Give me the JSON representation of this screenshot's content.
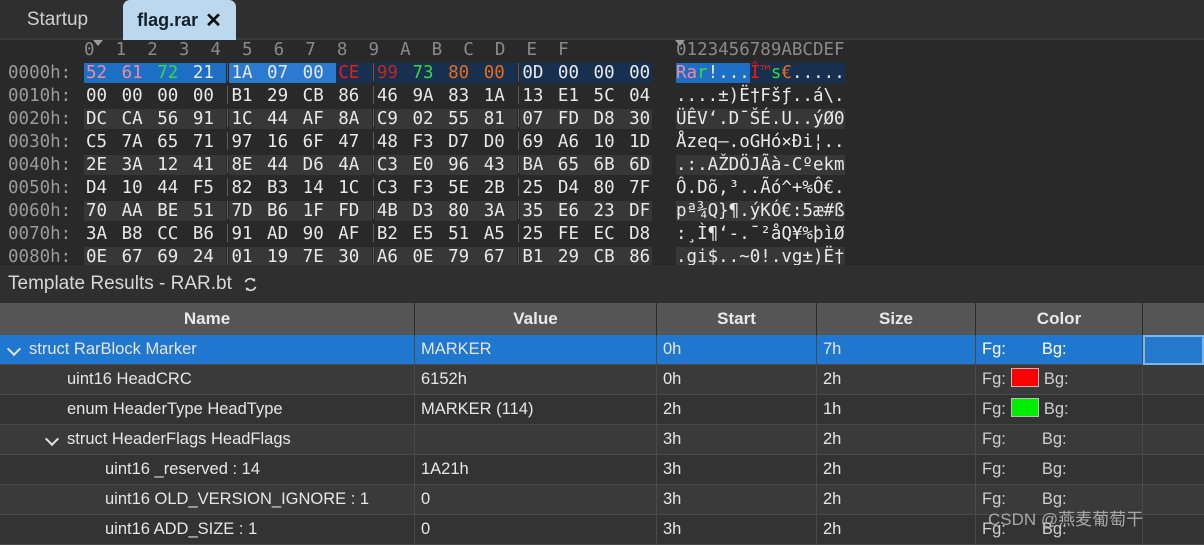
{
  "tabs": [
    {
      "label": "Startup",
      "active": false
    },
    {
      "label": "flag.rar",
      "active": true,
      "close_glyph": "✕"
    }
  ],
  "hex_editor": {
    "column_header": "0  1  2  3  4  5  6  7  8  9  A  B  C  D  E  F",
    "ascii_header": "0123456789ABCDEF",
    "rows": [
      {
        "offset": "0000h:",
        "ascii": "Rar!...Î™s€....."
      },
      {
        "offset": "0010h:",
        "ascii": "....±)Ë†Fšƒ..á\\."
      },
      {
        "offset": "0020h:",
        "ascii": "ÜÊV‘.D¯ŠÉ.U..ýØ0"
      },
      {
        "offset": "0030h:",
        "ascii": "Åzeq—.oGHó×Ði¦.."
      },
      {
        "offset": "0040h:",
        "ascii": ".:.AŽDÖJÃà-Cºekm"
      },
      {
        "offset": "0050h:",
        "ascii": "Ô.Dõ,³..Ãó^+%Ô€."
      },
      {
        "offset": "0060h:",
        "ascii": "pª¾Q}¶.ýKÓ€:5æ#ß"
      },
      {
        "offset": "0070h:",
        "ascii": ":¸Ì¶‘-.¯²åQ¥%þìØ"
      },
      {
        "offset": "0080h:",
        "ascii": ".gi$..~0!.vg±)Ë†"
      }
    ],
    "bytes": [
      [
        "52",
        "61",
        "72",
        "21",
        "1A",
        "07",
        "00",
        "CE",
        "99",
        "73",
        "80",
        "00",
        "0D",
        "00",
        "00",
        "00"
      ],
      [
        "00",
        "00",
        "00",
        "00",
        "B1",
        "29",
        "CB",
        "86",
        "46",
        "9A",
        "83",
        "1A",
        "13",
        "E1",
        "5C",
        "04"
      ],
      [
        "DC",
        "CA",
        "56",
        "91",
        "1C",
        "44",
        "AF",
        "8A",
        "C9",
        "02",
        "55",
        "81",
        "07",
        "FD",
        "D8",
        "30"
      ],
      [
        "C5",
        "7A",
        "65",
        "71",
        "97",
        "16",
        "6F",
        "47",
        "48",
        "F3",
        "D7",
        "D0",
        "69",
        "A6",
        "10",
        "1D"
      ],
      [
        "2E",
        "3A",
        "12",
        "41",
        "8E",
        "44",
        "D6",
        "4A",
        "C3",
        "E0",
        "96",
        "43",
        "BA",
        "65",
        "6B",
        "6D"
      ],
      [
        "D4",
        "10",
        "44",
        "F5",
        "82",
        "B3",
        "14",
        "1C",
        "C3",
        "F3",
        "5E",
        "2B",
        "25",
        "D4",
        "80",
        "7F"
      ],
      [
        "70",
        "AA",
        "BE",
        "51",
        "7D",
        "B6",
        "1F",
        "FD",
        "4B",
        "D3",
        "80",
        "3A",
        "35",
        "E6",
        "23",
        "DF"
      ],
      [
        "3A",
        "B8",
        "CC",
        "B6",
        "91",
        "AD",
        "90",
        "AF",
        "B2",
        "E5",
        "51",
        "A5",
        "25",
        "FE",
        "EC",
        "D8"
      ],
      [
        "0E",
        "67",
        "69",
        "24",
        "01",
        "19",
        "7E",
        "30",
        "A6",
        "0E",
        "79",
        "67",
        "B1",
        "29",
        "CB",
        "86"
      ]
    ],
    "highlight_colors": {
      "selection_strong": "#1c6fc4",
      "selection_mid": "#2a7ad1",
      "selection_dark": "#17304f",
      "pink": "#f08a9c",
      "green": "#34d94a",
      "red": "#f51616",
      "dark_red": "#c0271f",
      "orange": "#ec6b18"
    }
  },
  "template_results": {
    "title": "Template Results - RAR.bt",
    "refresh_icon": "refresh-icon",
    "columns": [
      "Name",
      "Value",
      "Start",
      "Size",
      "Color"
    ],
    "fg_label": "Fg:",
    "bg_label": "Bg:",
    "rows": [
      {
        "name": "struct RarBlock Marker",
        "indent": 1,
        "chevron": true,
        "value": "MARKER",
        "start": "0h",
        "size": "7h",
        "fg_color": null,
        "bg_color": null,
        "selected": true
      },
      {
        "name": "uint16 HeadCRC",
        "indent": 2,
        "chevron": false,
        "value": "6152h",
        "start": "0h",
        "size": "2h",
        "fg_color": "#ff0000",
        "bg_color": null,
        "selected": false
      },
      {
        "name": "enum HeaderType HeadType",
        "indent": 2,
        "chevron": false,
        "value": "MARKER (114)",
        "start": "2h",
        "size": "1h",
        "fg_color": "#00ee00",
        "bg_color": null,
        "selected": false
      },
      {
        "name": "struct HeaderFlags HeadFlags",
        "indent": 2,
        "chevron": true,
        "value": "",
        "start": "3h",
        "size": "2h",
        "fg_color": null,
        "bg_color": null,
        "selected": false
      },
      {
        "name": "uint16 _reserved : 14",
        "indent": 3,
        "chevron": false,
        "value": "1A21h",
        "start": "3h",
        "size": "2h",
        "fg_color": null,
        "bg_color": null,
        "selected": false
      },
      {
        "name": "uint16 OLD_VERSION_IGNORE : 1",
        "indent": 3,
        "chevron": false,
        "value": "0",
        "start": "3h",
        "size": "2h",
        "fg_color": null,
        "bg_color": null,
        "selected": false
      },
      {
        "name": "uint16 ADD_SIZE : 1",
        "indent": 3,
        "chevron": false,
        "value": "0",
        "start": "3h",
        "size": "2h",
        "fg_color": null,
        "bg_color": null,
        "selected": false
      }
    ]
  },
  "watermark": "CSDN @燕麦葡萄干"
}
